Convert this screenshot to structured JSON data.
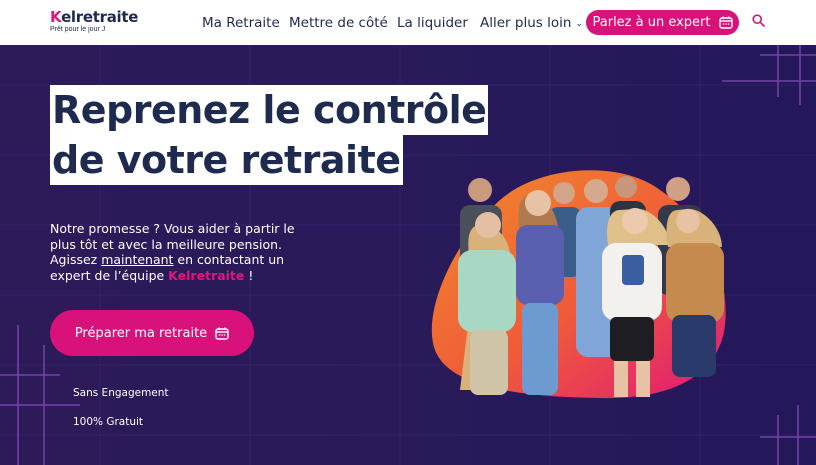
{
  "brand": {
    "name_k": "K",
    "name_rest": "elretraite",
    "tagline": "Prêt pour le jour J"
  },
  "nav": {
    "items": [
      {
        "label": "Ma Retraite"
      },
      {
        "label": "Mettre de côté"
      },
      {
        "label": "La liquider"
      },
      {
        "label": "Aller plus loin",
        "has_dropdown": true
      }
    ],
    "cta_label": "Parlez à un expert"
  },
  "hero": {
    "title_line1": "Reprenez le contrôle",
    "title_line2": "de votre retraite",
    "promise_part1": "Notre promesse ? Vous aider à partir le plus tôt et avec la meilleure pension. Agissez ",
    "promise_link": "maintenant",
    "promise_part2": " en contactant un expert de l’équipe ",
    "promise_brand": "Kelretraite",
    "promise_end": " !",
    "cta_label": "Préparer ma retraite",
    "features": [
      "Sans Engagement",
      "100% Gratuit"
    ]
  },
  "colors": {
    "accent": "#d8127a",
    "navy": "#1f2a4f",
    "hero_bg": "#2a1a5a",
    "blob_orange": "#f07a2a",
    "blob_pink": "#e0177a"
  },
  "icons": {
    "calendar": "calendar-icon",
    "search": "search-icon",
    "chevron": "chevron-down-icon"
  }
}
